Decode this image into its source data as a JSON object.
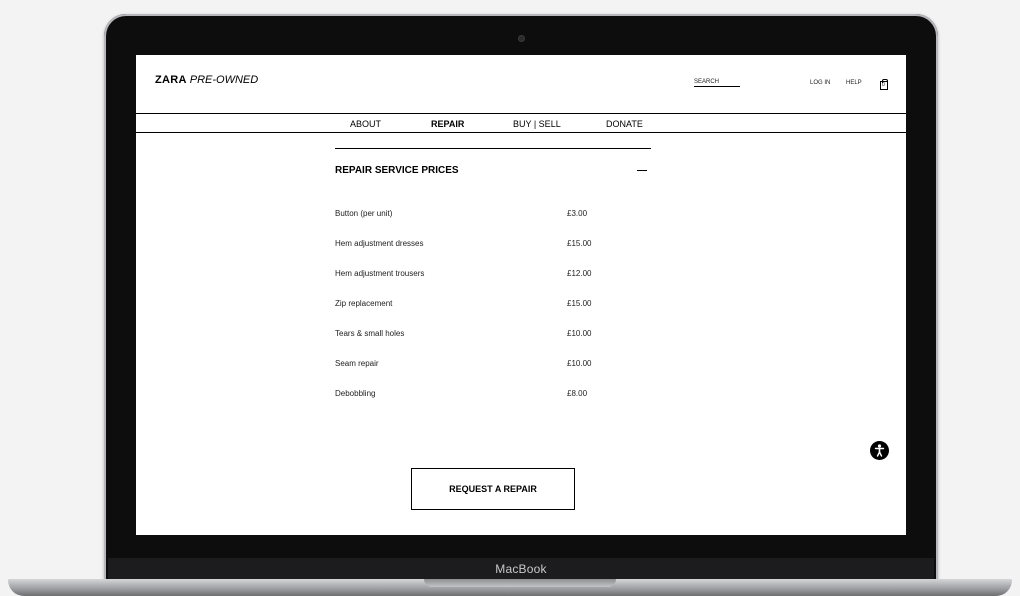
{
  "device": {
    "label": "MacBook"
  },
  "header": {
    "logo_brand": "ZARA",
    "logo_sub": "PRE-OWNED",
    "search_label": "SEARCH",
    "login_label": "LOG IN",
    "help_label": "HELP",
    "bag_count": "0"
  },
  "nav": {
    "items": [
      {
        "label": "ABOUT",
        "active": false
      },
      {
        "label": "REPAIR",
        "active": true
      },
      {
        "label": "BUY | SELL",
        "active": false
      },
      {
        "label": "DONATE",
        "active": false
      }
    ]
  },
  "section": {
    "title": "REPAIR SERVICE PRICES",
    "prices": [
      {
        "service": "Button (per unit)",
        "price": "£3.00"
      },
      {
        "service": "Hem adjustment dresses",
        "price": "£15.00"
      },
      {
        "service": "Hem adjustment trousers",
        "price": "£12.00"
      },
      {
        "service": "Zip replacement",
        "price": "£15.00"
      },
      {
        "service": "Tears & small holes",
        "price": "£10.00"
      },
      {
        "service": "Seam repair",
        "price": "£10.00"
      },
      {
        "service": "Debobbling",
        "price": "£8.00"
      }
    ]
  },
  "cta": {
    "label": "REQUEST A REPAIR"
  }
}
